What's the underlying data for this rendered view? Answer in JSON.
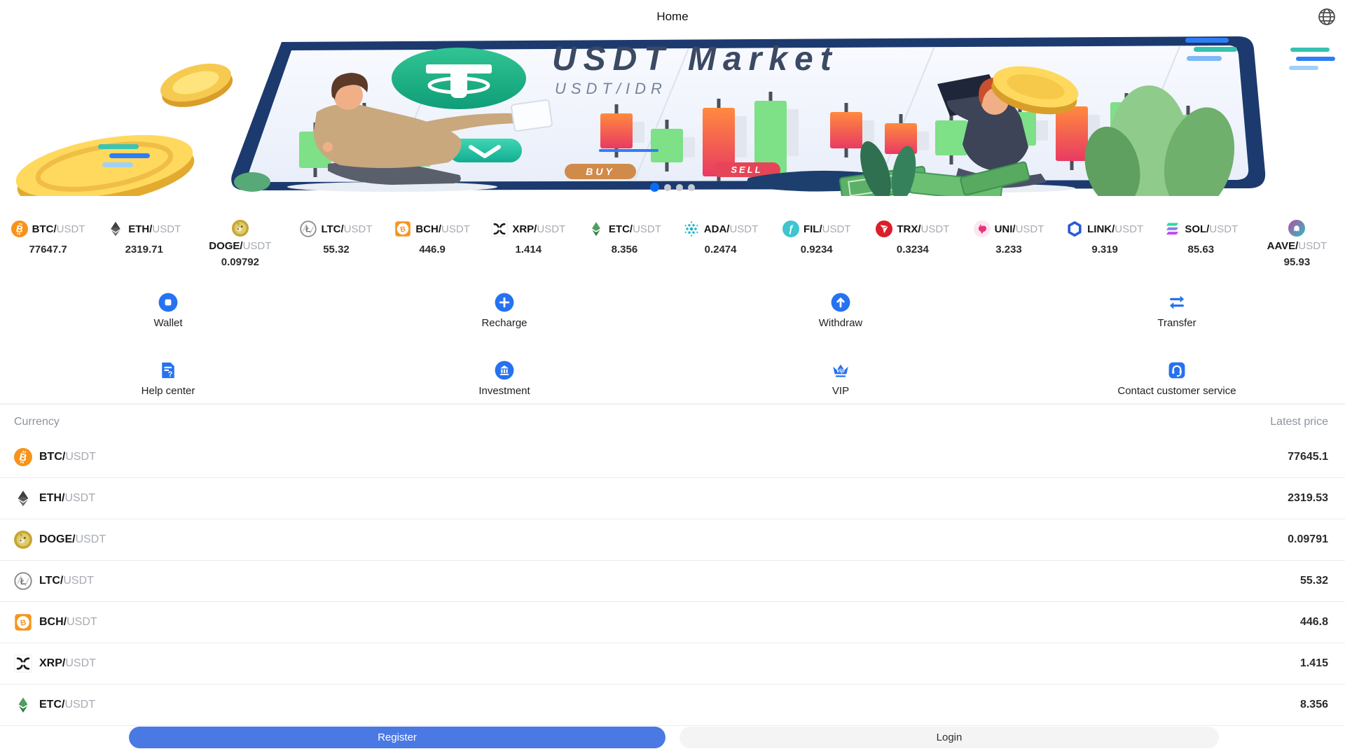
{
  "header": {
    "title": "Home",
    "language_icon": "globe-icon"
  },
  "banner": {
    "title": "USDT Market",
    "subtitle": "USDT/IDR",
    "buy_label": "BUY",
    "sell_label": "SELL",
    "dots_count": 4,
    "active_dot": 0
  },
  "ticker": {
    "items": [
      {
        "symbol": "BTC",
        "quote": "USDT",
        "price": "77647.7",
        "icon": "btc-icon",
        "stacked": false
      },
      {
        "symbol": "ETH",
        "quote": "USDT",
        "price": "2319.71",
        "icon": "eth-icon",
        "stacked": false
      },
      {
        "symbol": "DOGE",
        "quote": "USDT",
        "price": "0.09792",
        "icon": "doge-icon",
        "stacked": true
      },
      {
        "symbol": "LTC",
        "quote": "USDT",
        "price": "55.32",
        "icon": "ltc-icon",
        "stacked": false
      },
      {
        "symbol": "BCH",
        "quote": "USDT",
        "price": "446.9",
        "icon": "bch-icon",
        "stacked": false
      },
      {
        "symbol": "XRP",
        "quote": "USDT",
        "price": "1.414",
        "icon": "xrp-icon",
        "stacked": false
      },
      {
        "symbol": "ETC",
        "quote": "USDT",
        "price": "8.356",
        "icon": "etc-icon",
        "stacked": false
      },
      {
        "symbol": "ADA",
        "quote": "USDT",
        "price": "0.2474",
        "icon": "ada-icon",
        "stacked": false
      },
      {
        "symbol": "FIL",
        "quote": "USDT",
        "price": "0.9234",
        "icon": "fil-icon",
        "stacked": false
      },
      {
        "symbol": "TRX",
        "quote": "USDT",
        "price": "0.3234",
        "icon": "trx-icon",
        "stacked": false
      },
      {
        "symbol": "UNI",
        "quote": "USDT",
        "price": "3.233",
        "icon": "uni-icon",
        "stacked": false
      },
      {
        "symbol": "LINK",
        "quote": "USDT",
        "price": "9.319",
        "icon": "link-icon",
        "stacked": false
      },
      {
        "symbol": "SOL",
        "quote": "USDT",
        "price": "85.63",
        "icon": "sol-icon",
        "stacked": false
      },
      {
        "symbol": "AAVE",
        "quote": "USDT",
        "price": "95.93",
        "icon": "aave-icon",
        "stacked": true
      }
    ]
  },
  "actions": {
    "items": [
      {
        "label": "Wallet",
        "icon": "wallet-icon"
      },
      {
        "label": "Recharge",
        "icon": "recharge-icon"
      },
      {
        "label": "Withdraw",
        "icon": "withdraw-icon"
      },
      {
        "label": "Transfer",
        "icon": "transfer-icon"
      },
      {
        "label": "Help center",
        "icon": "help-center-icon"
      },
      {
        "label": "Investment",
        "icon": "investment-icon"
      },
      {
        "label": "VIP",
        "icon": "vip-icon"
      },
      {
        "label": "Contact customer service",
        "icon": "customer-service-icon"
      }
    ]
  },
  "market": {
    "columns": {
      "currency": "Currency",
      "latest_price": "Latest price"
    },
    "rows": [
      {
        "symbol": "BTC",
        "quote": "USDT",
        "price": "77645.1",
        "icon": "btc-icon"
      },
      {
        "symbol": "ETH",
        "quote": "USDT",
        "price": "2319.53",
        "icon": "eth-icon"
      },
      {
        "symbol": "DOGE",
        "quote": "USDT",
        "price": "0.09791",
        "icon": "doge-icon"
      },
      {
        "symbol": "LTC",
        "quote": "USDT",
        "price": "55.32",
        "icon": "ltc-icon"
      },
      {
        "symbol": "BCH",
        "quote": "USDT",
        "price": "446.8",
        "icon": "bch-icon"
      },
      {
        "symbol": "XRP",
        "quote": "USDT",
        "price": "1.415",
        "icon": "xrp-icon"
      },
      {
        "symbol": "ETC",
        "quote": "USDT",
        "price": "8.356",
        "icon": "etc-icon"
      }
    ]
  },
  "footer": {
    "register_label": "Register",
    "login_label": "Login"
  },
  "colors": {
    "accent_blue": "#2672f0",
    "register_blue": "#4b79e4",
    "login_gray": "#f4f4f5",
    "active_dot_blue": "#0a6cf5",
    "btc_orange": "#f7931a",
    "quote_gray": "#a6abb2"
  }
}
